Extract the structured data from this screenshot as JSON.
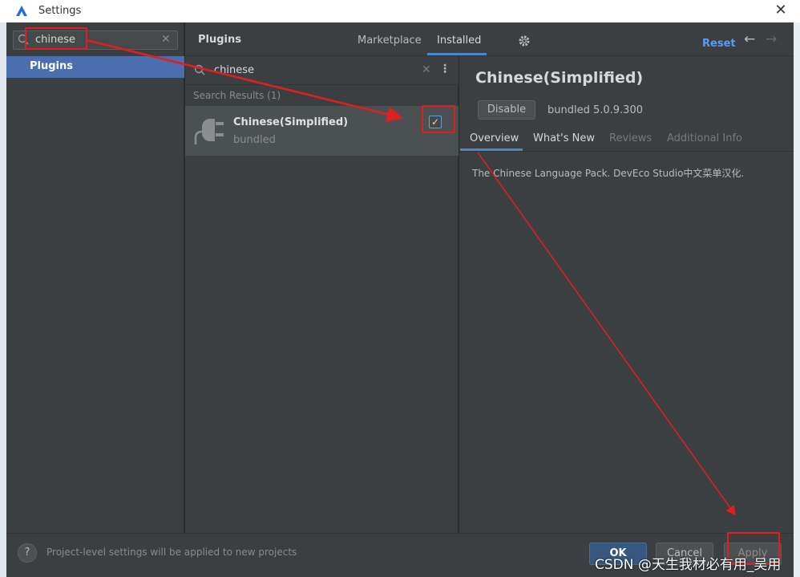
{
  "window": {
    "title": "Settings"
  },
  "sidebar": {
    "search_value": "chinese",
    "items": [
      {
        "label": "Plugins"
      }
    ]
  },
  "header": {
    "title": "Plugins",
    "tabs": [
      {
        "label": "Marketplace"
      },
      {
        "label": "Installed"
      }
    ],
    "reset_label": "Reset"
  },
  "list": {
    "search_value": "chinese",
    "results_label": "Search Results (1)",
    "items": [
      {
        "name": "Chinese(Simplified)",
        "status": "bundled",
        "enabled": true
      }
    ]
  },
  "detail": {
    "title": "Chinese(Simplified)",
    "disable_label": "Disable",
    "version": "bundled 5.0.9.300",
    "tabs": [
      {
        "label": "Overview"
      },
      {
        "label": "What's New"
      },
      {
        "label": "Reviews"
      },
      {
        "label": "Additional Info"
      }
    ],
    "description": "The Chinese Language Pack. DevEco Studio中文菜单汉化."
  },
  "footer": {
    "note": "Project-level settings will be applied to new projects",
    "ok_label": "OK",
    "cancel_label": "Cancel",
    "apply_label": "Apply",
    "help_label": "?"
  },
  "watermark": "CSDN @天生我材必有用_吴用",
  "colors": {
    "accent": "#4b6eaf",
    "link": "#589df6",
    "annotation": "#e02020",
    "panel": "#3c3f41"
  }
}
